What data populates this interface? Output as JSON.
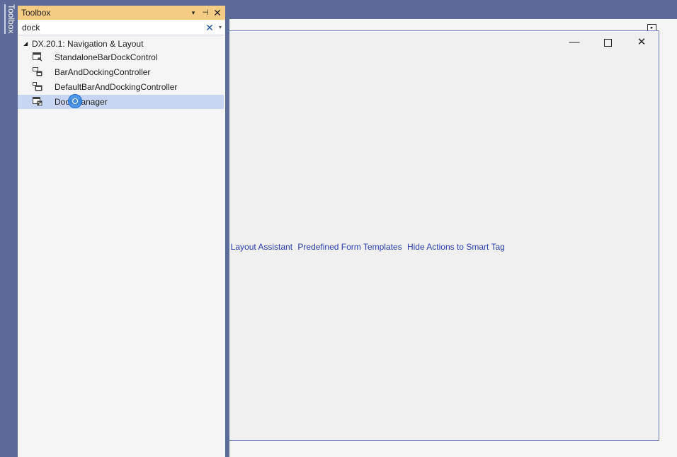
{
  "side_strip": {
    "tab_label": "Toolbox"
  },
  "toolbox": {
    "title": "Toolbox",
    "header_buttons": {
      "dropdown": "▾",
      "pin": "⊣",
      "close": "✕"
    },
    "search": {
      "value": "dock",
      "clear_icon": "✕",
      "dropdown_icon": "▾"
    },
    "group": {
      "expander": "◢",
      "label": "DX.20.1: Navigation & Layout"
    },
    "items": [
      {
        "label": "StandaloneBarDockControl",
        "icon": "standalone-bar-dock-icon"
      },
      {
        "label": "BarAndDockingController",
        "icon": "bar-docking-controller-icon"
      },
      {
        "label": "DefaultBarAndDockingController",
        "icon": "default-bar-docking-controller-icon"
      },
      {
        "label": "DockManager",
        "icon": "dock-manager-icon",
        "selected": true
      }
    ]
  },
  "designer": {
    "smart_tag": "▸",
    "window_controls": {
      "minimize": "—",
      "close": "✕"
    },
    "action_links": [
      "t Layout Assistant",
      "Predefined Form Templates",
      "Hide Actions to Smart Tag"
    ]
  },
  "colors": {
    "chrome": "#5d6b99",
    "toolbox_header": "#f5cc84",
    "selected_item": "#c9d6f3",
    "link": "#2a3caa"
  }
}
